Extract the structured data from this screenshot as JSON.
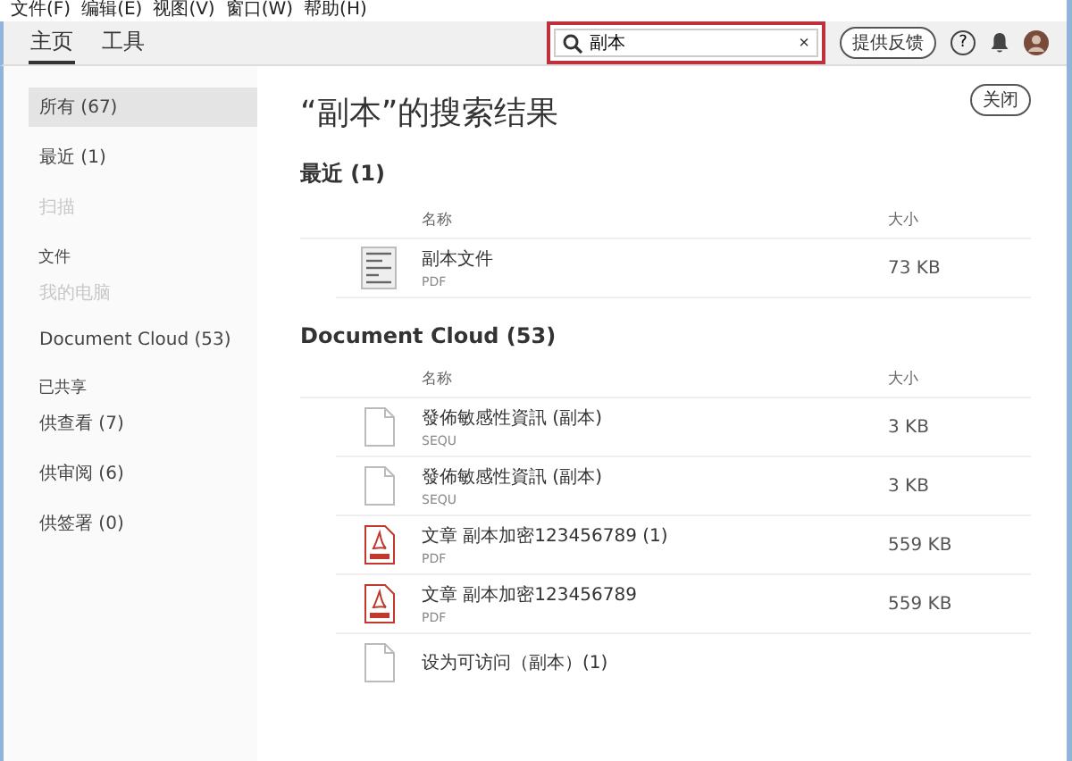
{
  "menu_bar": [
    "文件(F)",
    "编辑(E)",
    "视图(V)",
    "窗口(W)",
    "帮助(H)"
  ],
  "tabs": [
    {
      "label": "主页",
      "selected": true
    },
    {
      "label": "工具",
      "selected": false
    }
  ],
  "search": {
    "value": "副本",
    "clear": "×",
    "highlighted": true
  },
  "feedback_button": "提供反馈",
  "help_button": "?",
  "sidebar": {
    "items": [
      {
        "kind": "item",
        "label": "所有 (67)",
        "selected": true,
        "disabled": false
      },
      {
        "kind": "item",
        "label": "最近 (1)",
        "selected": false,
        "disabled": false
      },
      {
        "kind": "item",
        "label": "扫描",
        "selected": false,
        "disabled": true
      },
      {
        "kind": "heading",
        "label": "文件"
      },
      {
        "kind": "item",
        "label": "我的电脑",
        "selected": false,
        "disabled": true
      },
      {
        "kind": "item",
        "label": "Document Cloud (53)",
        "selected": false,
        "disabled": false
      },
      {
        "kind": "heading",
        "label": "已共享"
      },
      {
        "kind": "item",
        "label": "供查看 (7)",
        "selected": false,
        "disabled": false
      },
      {
        "kind": "item",
        "label": "供审阅 (6)",
        "selected": false,
        "disabled": false
      },
      {
        "kind": "item",
        "label": "供签署 (0)",
        "selected": false,
        "disabled": false
      }
    ]
  },
  "results_title": "“副本”的搜索结果",
  "close_button": "关闭",
  "sections": [
    {
      "title": "最近 (1)",
      "columns": [
        "名称",
        "大小"
      ],
      "files": [
        {
          "kind": "thumbnail",
          "name": "副本文件",
          "type": "PDF",
          "size": "73 KB"
        }
      ]
    },
    {
      "title": "Document Cloud (53)",
      "columns": [
        "名称",
        "大小"
      ],
      "files": [
        {
          "kind": "blank",
          "name": "發佈敏感性資訊 (副本)",
          "type": "SEQU",
          "size": "3 KB"
        },
        {
          "kind": "blank",
          "name": "發佈敏感性資訊 (副本)",
          "type": "SEQU",
          "size": "3 KB"
        },
        {
          "kind": "pdf",
          "name": "文章 副本加密123456789 (1)",
          "type": "PDF",
          "size": "559 KB"
        },
        {
          "kind": "pdf",
          "name": "文章 副本加密123456789",
          "type": "PDF",
          "size": "559 KB"
        },
        {
          "kind": "blank",
          "name": "设为可访问（副本）(1)"
        }
      ]
    }
  ]
}
